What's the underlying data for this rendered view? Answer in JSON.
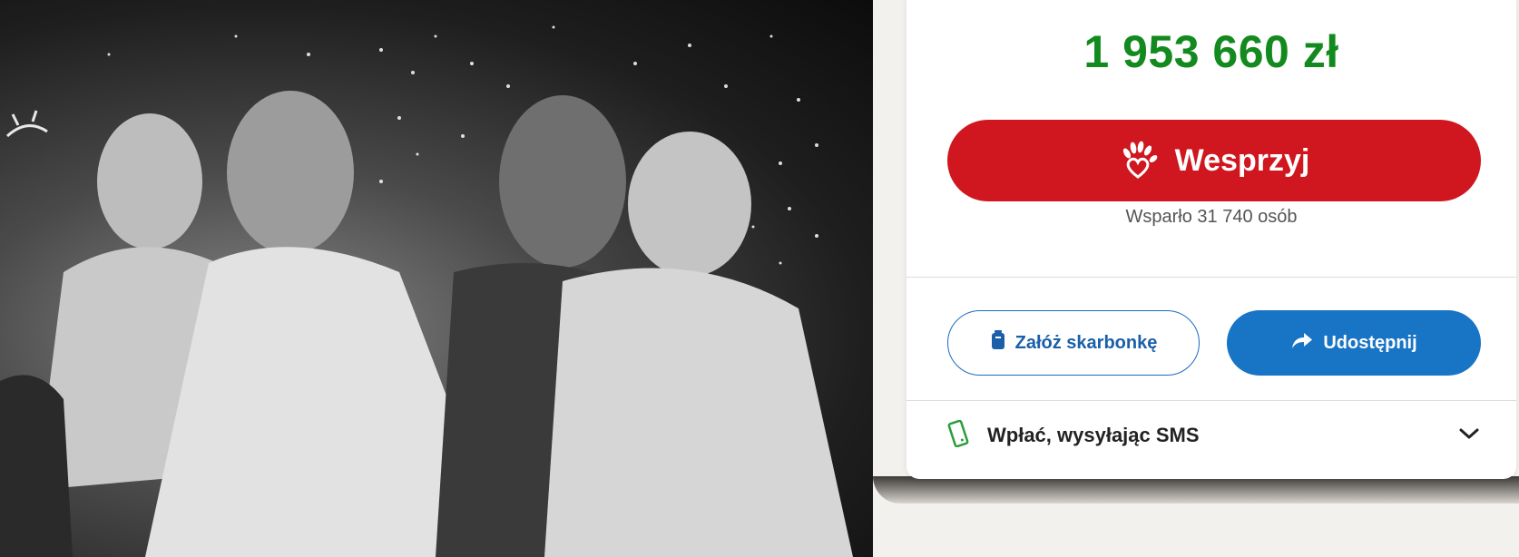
{
  "campaign": {
    "amount": "1 953 660 zł",
    "support_button_label": "Wesprzyj",
    "supporters_text": "Wsparło 31 740 osób",
    "piggy_bank_label": "Załóż skarbonkę",
    "share_label": "Udostępnij",
    "sms_label": "Wpłać, wysyłając SMS"
  },
  "icons": {
    "support": "heart-hand-icon",
    "piggy_bank": "piggy-bank-icon",
    "share": "share-arrow-icon",
    "sms": "phone-icon",
    "expand": "chevron-down-icon"
  },
  "colors": {
    "amount": "#128a1e",
    "support_button": "#d0161e",
    "share_button": "#1874c4",
    "outline_button": "#1a6cbf",
    "sms_icon": "#2a9d3a"
  }
}
